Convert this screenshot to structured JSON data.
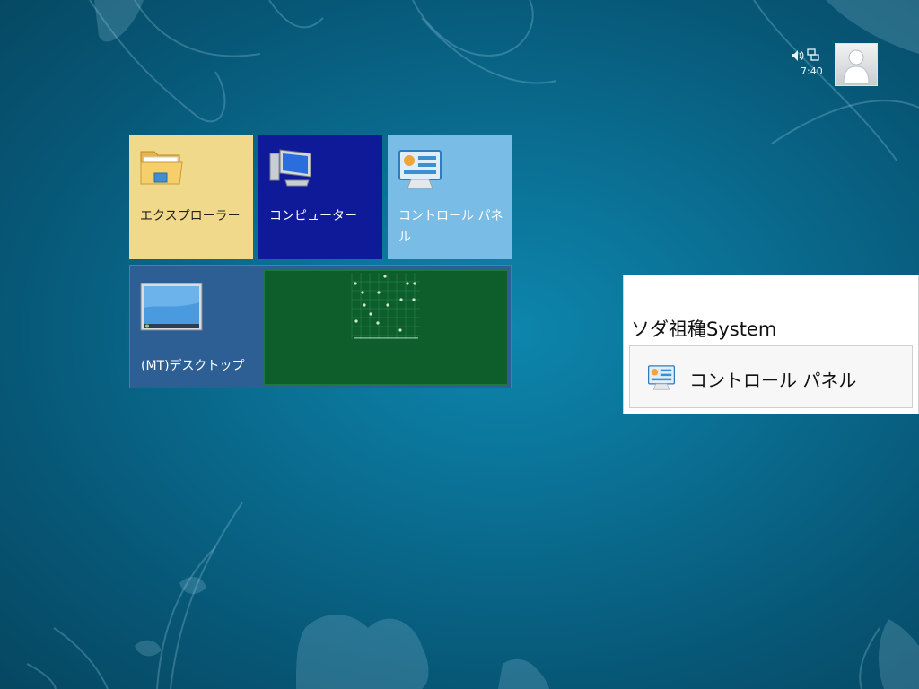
{
  "tray": {
    "clock": "7:40"
  },
  "tiles": [
    {
      "name": "explorer",
      "label": "エクスプローラー"
    },
    {
      "name": "computer",
      "label": "コンピューター"
    },
    {
      "name": "control-panel",
      "label": "コントロール パネル"
    },
    {
      "name": "desktop",
      "label": "(MT)デスクトップ"
    }
  ],
  "popup": {
    "heading": "ソダ祖穐System",
    "item_label": "コントロール パネル"
  },
  "colors": {
    "explorer_tile": "#f0d98a",
    "computer_tile": "#0f1a99",
    "control_panel_tile": "#79bde6",
    "desktop_tile": "#2d5f95",
    "desktop_preview": "#0d5e2b"
  },
  "icons": [
    "speaker-icon",
    "network-icon",
    "user-avatar",
    "folder-icon",
    "computer-icon",
    "control-panel-icon",
    "desktop-icon"
  ]
}
